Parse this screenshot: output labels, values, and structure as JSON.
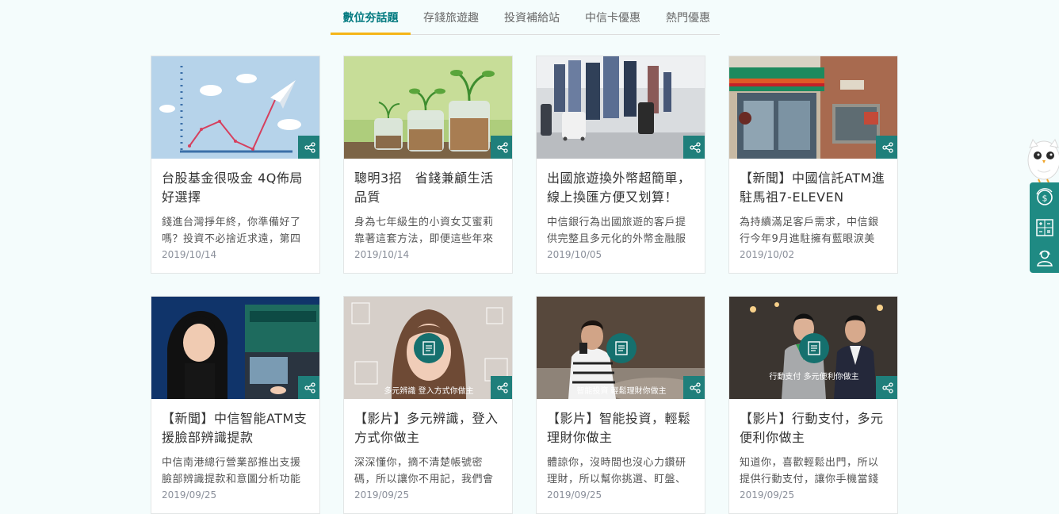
{
  "tabs": [
    {
      "label": "數位夯話題",
      "active": true
    },
    {
      "label": "存錢旅遊趣",
      "active": false
    },
    {
      "label": "投資補給站",
      "active": false
    },
    {
      "label": "中信卡優惠",
      "active": false
    },
    {
      "label": "熱門優惠",
      "active": false
    }
  ],
  "cards": [
    {
      "title": "台股基金很吸金 4Q佈局好選擇",
      "desc": "錢進台灣掙年終，你準備好了嗎？投資不必捨近求遠，第四",
      "date": "2019/10/14",
      "image": "chart-plane-illustration"
    },
    {
      "title": "聰明3招　省錢兼顧生活品質",
      "desc": "身為七年級生的小資女艾蜜莉靠著這套方法，即便這些年來",
      "date": "2019/10/14",
      "image": "coin-jars-plants"
    },
    {
      "title": "出國旅遊換外幣超簡單，線上換匯方便又划算！",
      "desc": "中信銀行為出國旅遊的客戶提供完整且多元化的外幣金融服",
      "date": "2019/10/05",
      "image": "airport-travelers"
    },
    {
      "title": "【新聞】中國信託ATM進駐馬祖7-ELEVEN",
      "desc": "為持續滿足客戶需求，中信銀行今年9月進駐擁有藍眼淚美",
      "date": "2019/10/02",
      "image": "convenience-store-front"
    },
    {
      "title": "【新聞】中信智能ATM支援臉部辨識提款",
      "desc": "中信南港總行營業部推出支援臉部辨識提款和意圖分析功能",
      "date": "2019/09/25",
      "image": "woman-at-atm"
    },
    {
      "title": "【影片】多元辨識，登入方式你做主",
      "desc": "深深懂你，摘不清楚帳號密碼，所以讓你不用記，我們會",
      "date": "2019/09/25",
      "image": "face-recognition-video",
      "caption": "多元辨識 登入方式你做主"
    },
    {
      "title": "【影片】智能投資，輕鬆理財你做主",
      "desc": "體諒你，沒時間也沒心力鑽研理財，所以幫你挑選、盯盤、",
      "date": "2019/09/25",
      "image": "smart-investing-video",
      "caption": "智能投資 輕鬆理財你做主"
    },
    {
      "title": "【影片】行動支付，多元便利你做主",
      "desc": "知道你，喜歡輕鬆出門，所以提供行動支付，讓你手機當錢",
      "date": "2019/09/25",
      "image": "mobile-payment-video",
      "caption": "行動支付 多元便利你做主"
    }
  ],
  "float_menu": [
    {
      "icon": "currency-exchange-icon"
    },
    {
      "icon": "calculator-icon"
    },
    {
      "icon": "customer-service-icon"
    }
  ],
  "colors": {
    "accent": "#00797f",
    "tab_underline": "#f5b518",
    "share_button": "#1f7f7b",
    "float_panel": "#1f8a83",
    "date": "#8a8f9a",
    "page_bg": "#f4fcfc"
  }
}
